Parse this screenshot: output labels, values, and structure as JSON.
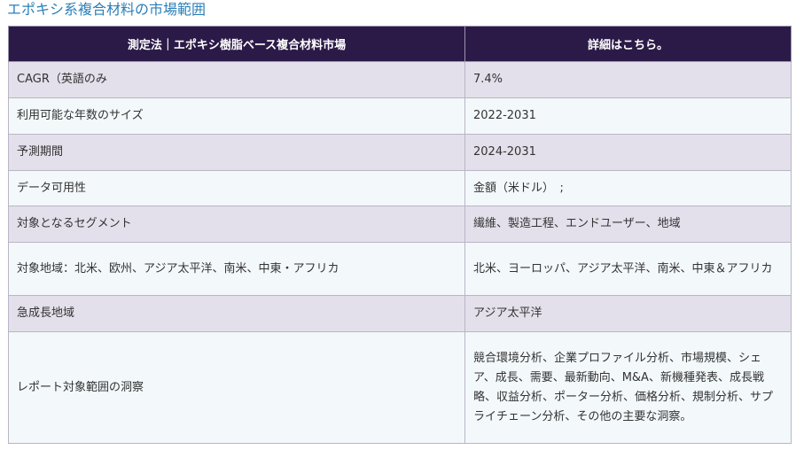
{
  "page": {
    "title": "エポキシ系複合材料の市場範囲"
  },
  "table": {
    "headers": [
      "測定法｜エポキシ樹脂ベース複合材料市場",
      "詳細はこちら。"
    ],
    "rows": [
      {
        "label": "CAGR（英語のみ",
        "value": "7.4%"
      },
      {
        "label": "利用可能な年数のサイズ",
        "value": "2022-2031"
      },
      {
        "label": "予測期間",
        "value": "2024-2031"
      },
      {
        "label": "データ可用性",
        "value": "金額（米ドル）　;"
      },
      {
        "label": "対象となるセグメント",
        "value": "繊維、製造工程、エンドユーザー、地域"
      },
      {
        "label": "対象地域：北米、欧州、アジア太平洋、南米、中東・アフリカ",
        "value": "北米、ヨーロッパ、アジア太平洋、南米、中東＆アフリカ"
      },
      {
        "label": "急成長地域",
        "value": "アジア太平洋"
      },
      {
        "label": "レポート対象範囲の洞察",
        "value": "競合環境分析、企業プロファイル分析、市場規模、シェア、成長、需要、最新動向、M&A、新機種発表、成長戦略、収益分析、ポーター分析、価格分析、規制分析、サプライチェーン分析、その他の主要な洞察。"
      }
    ]
  },
  "colors": {
    "title": "#2a7fb8",
    "header_bg": "#2b1a47",
    "row_odd_bg": "#e3e0eb",
    "row_even_bg": "#f3f8fb"
  }
}
